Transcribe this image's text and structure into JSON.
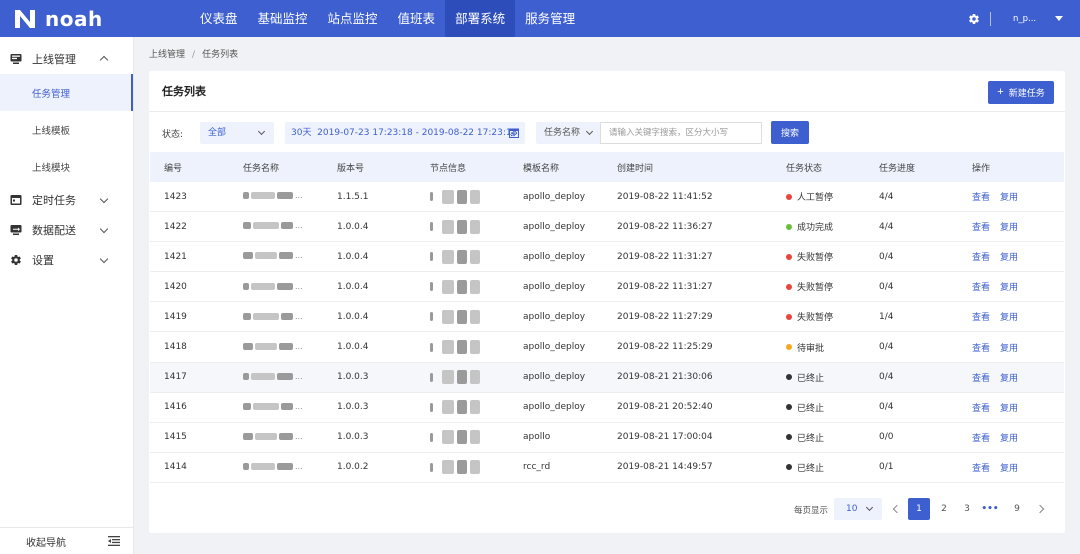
{
  "app": {
    "logo_text": "noah"
  },
  "topnav": {
    "items": [
      "仪表盘",
      "基础监控",
      "站点监控",
      "值班表",
      "部署系统",
      "服务管理"
    ],
    "active_index": 4,
    "user": "n_p..."
  },
  "sidebar": {
    "groups": [
      {
        "label": "上线管理",
        "icon": "monitor-icon",
        "expanded": true
      },
      {
        "label": "定时任务",
        "icon": "calendar-icon",
        "expanded": false
      },
      {
        "label": "数据配送",
        "icon": "transfer-icon",
        "expanded": false
      },
      {
        "label": "设置",
        "icon": "gear-icon",
        "expanded": false
      }
    ],
    "sub_items": [
      "任务管理",
      "上线模板",
      "上线模块"
    ],
    "active_sub": 0,
    "collapse_label": "收起导航"
  },
  "breadcrumb": {
    "items": [
      "上线管理",
      "任务列表"
    ],
    "separator": "/"
  },
  "card": {
    "title": "任务列表",
    "new_button": "新建任务",
    "new_button_icon": "plus-icon"
  },
  "filter": {
    "status_label": "状态:",
    "status_value": "全部",
    "date_range": "30天  2019-07-23 17:23:18 - 2019-08-22 17:23:18",
    "search_type": "任务名称",
    "search_placeholder": "请输入关键字搜索，区分大小写",
    "search_button": "搜索"
  },
  "table": {
    "columns": [
      "编号",
      "任务名称",
      "版本号",
      "节点信息",
      "模板名称",
      "创建时间",
      "任务状态",
      "任务进度",
      "操作"
    ],
    "actions": [
      "查看",
      "复用"
    ],
    "rows": [
      {
        "id": "1423",
        "version": "1.1.5.1",
        "template": "apollo_deploy",
        "created": "2019-08-22 11:41:52",
        "status": "人工暂停",
        "status_color": "#e8453c",
        "progress": "4/4"
      },
      {
        "id": "1422",
        "version": "1.0.0.4",
        "template": "apollo_deploy",
        "created": "2019-08-22 11:36:27",
        "status": "成功完成",
        "status_color": "#67c23a",
        "progress": "4/4"
      },
      {
        "id": "1421",
        "version": "1.0.0.4",
        "template": "apollo_deploy",
        "created": "2019-08-22 11:31:27",
        "status": "失败暂停",
        "status_color": "#e8453c",
        "progress": "0/4"
      },
      {
        "id": "1420",
        "version": "1.0.0.4",
        "template": "apollo_deploy",
        "created": "2019-08-22 11:31:27",
        "status": "失败暂停",
        "status_color": "#e8453c",
        "progress": "0/4"
      },
      {
        "id": "1419",
        "version": "1.0.0.4",
        "template": "apollo_deploy",
        "created": "2019-08-22 11:27:29",
        "status": "失败暂停",
        "status_color": "#e8453c",
        "progress": "1/4"
      },
      {
        "id": "1418",
        "version": "1.0.0.4",
        "template": "apollo_deploy",
        "created": "2019-08-22 11:25:29",
        "status": "待审批",
        "status_color": "#f5a623",
        "progress": "0/4"
      },
      {
        "id": "1417",
        "version": "1.0.0.3",
        "template": "apollo_deploy",
        "created": "2019-08-21 21:30:06",
        "status": "已终止",
        "status_color": "#333333",
        "progress": "0/4"
      },
      {
        "id": "1416",
        "version": "1.0.0.3",
        "template": "apollo_deploy",
        "created": "2019-08-21 20:52:40",
        "status": "已终止",
        "status_color": "#333333",
        "progress": "0/4"
      },
      {
        "id": "1415",
        "version": "1.0.0.3",
        "template": "apollo",
        "created": "2019-08-21 17:00:04",
        "status": "已终止",
        "status_color": "#333333",
        "progress": "0/0"
      },
      {
        "id": "1414",
        "version": "1.0.0.2",
        "template": "rcc_rd",
        "created": "2019-08-21 14:49:57",
        "status": "已终止",
        "status_color": "#333333",
        "progress": "0/1"
      }
    ]
  },
  "pagination": {
    "per_page_label": "每页显示",
    "per_page": "10",
    "pages": [
      "1",
      "2",
      "3",
      "•••",
      "9"
    ],
    "active_page": "1"
  },
  "colors": {
    "primary": "#3d5fcf",
    "nav_active": "#2d4dbb",
    "light_bg": "#eef2fc"
  }
}
